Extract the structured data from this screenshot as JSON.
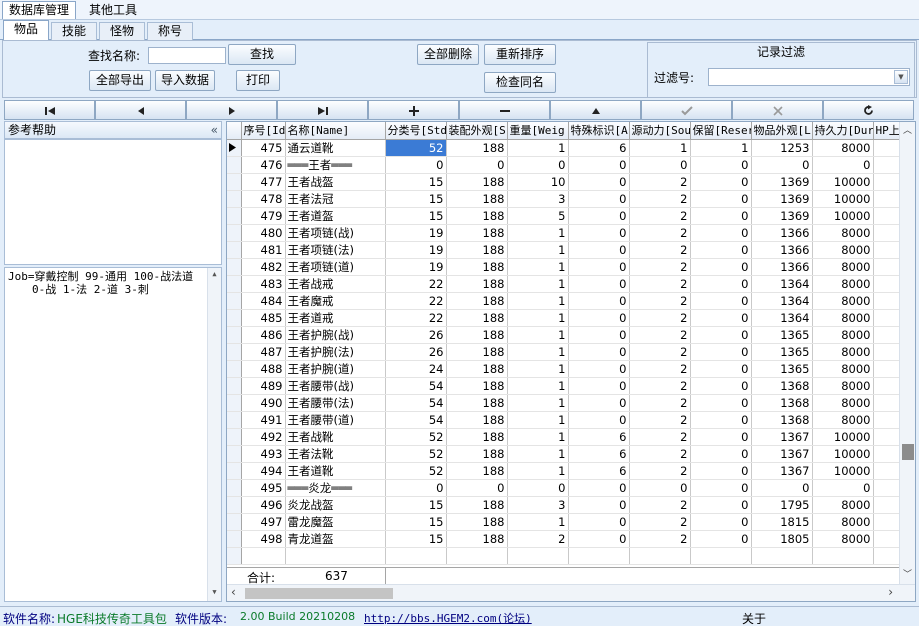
{
  "menu": [
    "数据库管理",
    "其他工具"
  ],
  "tabs": [
    "物品",
    "技能",
    "怪物",
    "称号"
  ],
  "toolbar": {
    "search_label": "查找名称:",
    "search_value": "",
    "search_button": "查找",
    "export_button": "全部导出",
    "import_button": "导入数据",
    "print_button": "打印",
    "delete_all_button": "全部删除",
    "resort_button": "重新排序",
    "check_dup_button": "检查同名"
  },
  "filter": {
    "title": "记录过滤",
    "label": "过滤号:",
    "value": ""
  },
  "navigator": [
    "first",
    "prior",
    "next",
    "last",
    "insert",
    "delete",
    "edit",
    "post",
    "cancel",
    "refresh"
  ],
  "help": {
    "title": "参考帮助",
    "collapse_glyph": "«",
    "text_line1": "Job=穿戴控制 99-通用 100-战法道",
    "text_line2": "0-战 1-法 2-道 3-刺"
  },
  "grid": {
    "columns": [
      "序号[Id",
      "名称[Name]",
      "分类号[Std",
      "装配外观[S",
      "重量[Weig",
      "特殊标识[A",
      "源动力[Sou",
      "保留[Reser",
      "物品外观[L",
      "持久力[Dur",
      "HP上"
    ],
    "rows": [
      [
        "475",
        "通云道靴",
        "52",
        "188",
        "1",
        "6",
        "1",
        "1",
        "1253",
        "8000"
      ],
      [
        "476",
        "═══王者═══",
        "0",
        "0",
        "0",
        "0",
        "0",
        "0",
        "0",
        "0"
      ],
      [
        "477",
        "王者战盔",
        "15",
        "188",
        "10",
        "0",
        "2",
        "0",
        "1369",
        "10000"
      ],
      [
        "478",
        "王者法冠",
        "15",
        "188",
        "3",
        "0",
        "2",
        "0",
        "1369",
        "10000"
      ],
      [
        "479",
        "王者道盔",
        "15",
        "188",
        "5",
        "0",
        "2",
        "0",
        "1369",
        "10000"
      ],
      [
        "480",
        "王者项链(战)",
        "19",
        "188",
        "1",
        "0",
        "2",
        "0",
        "1366",
        "8000"
      ],
      [
        "481",
        "王者项链(法)",
        "19",
        "188",
        "1",
        "0",
        "2",
        "0",
        "1366",
        "8000"
      ],
      [
        "482",
        "王者项链(道)",
        "19",
        "188",
        "1",
        "0",
        "2",
        "0",
        "1366",
        "8000"
      ],
      [
        "483",
        "王者战戒",
        "22",
        "188",
        "1",
        "0",
        "2",
        "0",
        "1364",
        "8000"
      ],
      [
        "484",
        "王者魔戒",
        "22",
        "188",
        "1",
        "0",
        "2",
        "0",
        "1364",
        "8000"
      ],
      [
        "485",
        "王者道戒",
        "22",
        "188",
        "1",
        "0",
        "2",
        "0",
        "1364",
        "8000"
      ],
      [
        "486",
        "王者护腕(战)",
        "26",
        "188",
        "1",
        "0",
        "2",
        "0",
        "1365",
        "8000"
      ],
      [
        "487",
        "王者护腕(法)",
        "26",
        "188",
        "1",
        "0",
        "2",
        "0",
        "1365",
        "8000"
      ],
      [
        "488",
        "王者护腕(道)",
        "24",
        "188",
        "1",
        "0",
        "2",
        "0",
        "1365",
        "8000"
      ],
      [
        "489",
        "王者腰带(战)",
        "54",
        "188",
        "1",
        "0",
        "2",
        "0",
        "1368",
        "8000"
      ],
      [
        "490",
        "王者腰带(法)",
        "54",
        "188",
        "1",
        "0",
        "2",
        "0",
        "1368",
        "8000"
      ],
      [
        "491",
        "王者腰带(道)",
        "54",
        "188",
        "1",
        "0",
        "2",
        "0",
        "1368",
        "8000"
      ],
      [
        "492",
        "王者战靴",
        "52",
        "188",
        "1",
        "6",
        "2",
        "0",
        "1367",
        "10000"
      ],
      [
        "493",
        "王者法靴",
        "52",
        "188",
        "1",
        "6",
        "2",
        "0",
        "1367",
        "10000"
      ],
      [
        "494",
        "王者道靴",
        "52",
        "188",
        "1",
        "6",
        "2",
        "0",
        "1367",
        "10000"
      ],
      [
        "495",
        "═══炎龙═══",
        "0",
        "0",
        "0",
        "0",
        "0",
        "0",
        "0",
        "0"
      ],
      [
        "496",
        "炎龙战盔",
        "15",
        "188",
        "3",
        "0",
        "2",
        "0",
        "1795",
        "8000"
      ],
      [
        "497",
        "雷龙魔盔",
        "15",
        "188",
        "1",
        "0",
        "2",
        "0",
        "1815",
        "8000"
      ],
      [
        "498",
        "青龙道盔",
        "15",
        "188",
        "2",
        "0",
        "2",
        "0",
        "1805",
        "8000"
      ]
    ],
    "footer_label": "合计:",
    "footer_count": "637"
  },
  "status": {
    "name_label": "软件名称:",
    "name_value": "HGE科技传奇工具包",
    "version_label": "软件版本:",
    "version_value": "2.00 Build 20210208",
    "url": "http://bbs.HGEM2.com(论坛)",
    "about": "关于"
  },
  "colors": {
    "background": "#e3eefa",
    "selected_cell": "#3b7bd5",
    "status_green": "#0a7a2a",
    "link_blue": "#000080"
  }
}
